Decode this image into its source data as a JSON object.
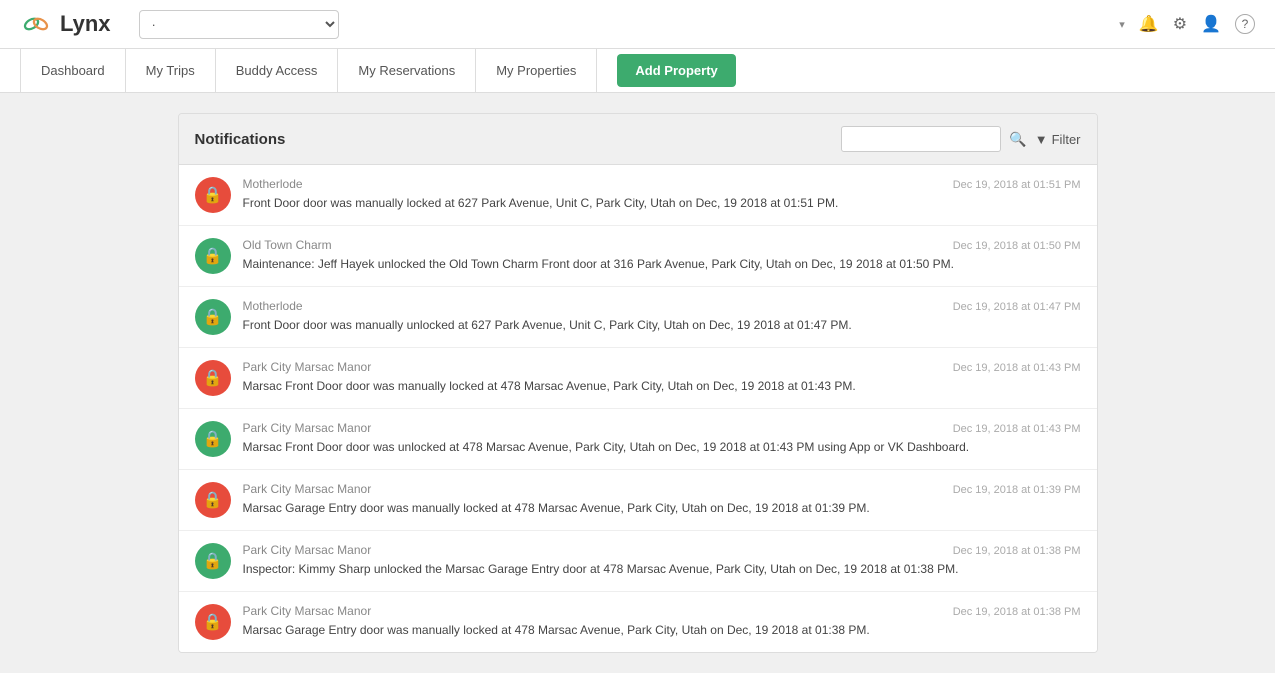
{
  "header": {
    "logo_text": "Lynx",
    "search_placeholder": "·",
    "user_label": "",
    "icons": {
      "dropdown": "▾",
      "bell": "🔔",
      "gear": "⚙",
      "user": "👤",
      "help": "?"
    }
  },
  "nav": {
    "items": [
      {
        "label": "Dashboard",
        "id": "dashboard"
      },
      {
        "label": "My Trips",
        "id": "my-trips"
      },
      {
        "label": "Buddy Access",
        "id": "buddy-access"
      },
      {
        "label": "My Reservations",
        "id": "my-reservations"
      },
      {
        "label": "My Properties",
        "id": "my-properties"
      }
    ],
    "add_button": "Add Property"
  },
  "notifications": {
    "title": "Notifications",
    "search_placeholder": "",
    "filter_label": "Filter",
    "items": [
      {
        "id": 1,
        "locked": true,
        "property": "Motherlode",
        "time": "Dec 19, 2018 at 01:51 PM",
        "message": "Front Door door was manually locked at 627 Park Avenue, Unit C, Park City, Utah on Dec, 19 2018 at 01:51 PM."
      },
      {
        "id": 2,
        "locked": false,
        "property": "Old Town Charm",
        "time": "Dec 19, 2018 at 01:50 PM",
        "message": "Maintenance: Jeff Hayek unlocked the Old Town Charm Front door at 316 Park Avenue, Park City, Utah on Dec, 19 2018 at 01:50 PM."
      },
      {
        "id": 3,
        "locked": false,
        "property": "Motherlode",
        "time": "Dec 19, 2018 at 01:47 PM",
        "message": "Front Door door was manually unlocked at 627 Park Avenue, Unit C, Park City, Utah on Dec, 19 2018 at 01:47 PM."
      },
      {
        "id": 4,
        "locked": true,
        "property": "Park City Marsac Manor",
        "time": "Dec 19, 2018 at 01:43 PM",
        "message": "Marsac Front Door door was manually locked at 478 Marsac Avenue, Park City, Utah on Dec, 19 2018 at 01:43 PM."
      },
      {
        "id": 5,
        "locked": false,
        "property": "Park City Marsac Manor",
        "time": "Dec 19, 2018 at 01:43 PM",
        "message": "Marsac Front Door door was unlocked at 478 Marsac Avenue, Park City, Utah on Dec, 19 2018 at 01:43 PM using App or VK Dashboard."
      },
      {
        "id": 6,
        "locked": true,
        "property": "Park City Marsac Manor",
        "time": "Dec 19, 2018 at 01:39 PM",
        "message": "Marsac Garage Entry door was manually locked at 478 Marsac Avenue, Park City, Utah on Dec, 19 2018 at 01:39 PM."
      },
      {
        "id": 7,
        "locked": false,
        "property": "Park City Marsac Manor",
        "time": "Dec 19, 2018 at 01:38 PM",
        "message": "Inspector: Kimmy Sharp unlocked the Marsac Garage Entry door at 478 Marsac Avenue, Park City, Utah on Dec, 19 2018 at 01:38 PM."
      },
      {
        "id": 8,
        "locked": true,
        "property": "Park City Marsac Manor",
        "time": "Dec 19, 2018 at 01:38 PM",
        "message": "Marsac Garage Entry door was manually locked at 478 Marsac Avenue, Park City, Utah on Dec, 19 2018 at 01:38 PM."
      }
    ]
  }
}
